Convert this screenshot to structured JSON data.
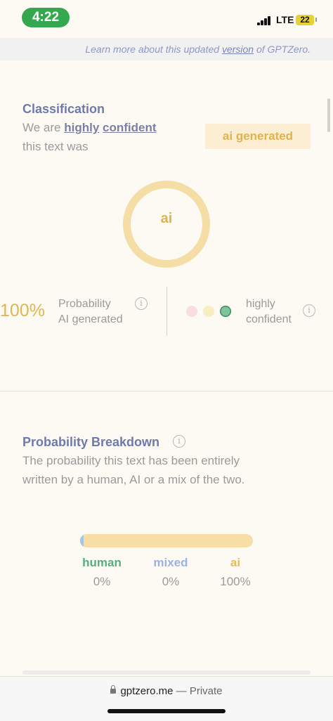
{
  "status_bar": {
    "time": "4:22",
    "network": "LTE",
    "battery": "22"
  },
  "notice": {
    "prefix": "Learn more about this updated ",
    "link": "version",
    "suffix": " of GPTZero."
  },
  "classification": {
    "title": "Classification",
    "line1_prefix": "We are ",
    "line1_word1": "highly",
    "line1_word2": "confident",
    "line2": "this text was",
    "verdict": "ai generated",
    "ring_label": "ai",
    "probability_value": "100%",
    "probability_label_1": "Probability",
    "probability_label_2": "AI generated",
    "confidence_label_1": "highly",
    "confidence_label_2": "confident",
    "confidence_colors": [
      "#f9dde0",
      "#f7efbf",
      "#7fc39b"
    ]
  },
  "breakdown": {
    "title": "Probability Breakdown",
    "desc_line1": "The probability this text has been entirely",
    "desc_line2": "written by a human, AI or a mix of the two.",
    "human": {
      "label": "human",
      "value": "0%",
      "color": "#57ae7c"
    },
    "mixed": {
      "label": "mixed",
      "value": "0%",
      "color": "#9fb0e6"
    },
    "ai": {
      "label": "ai",
      "value": "100%",
      "color": "#e7bd55"
    }
  },
  "browser": {
    "domain": "gptzero.me",
    "separator": " — ",
    "mode": "Private"
  }
}
